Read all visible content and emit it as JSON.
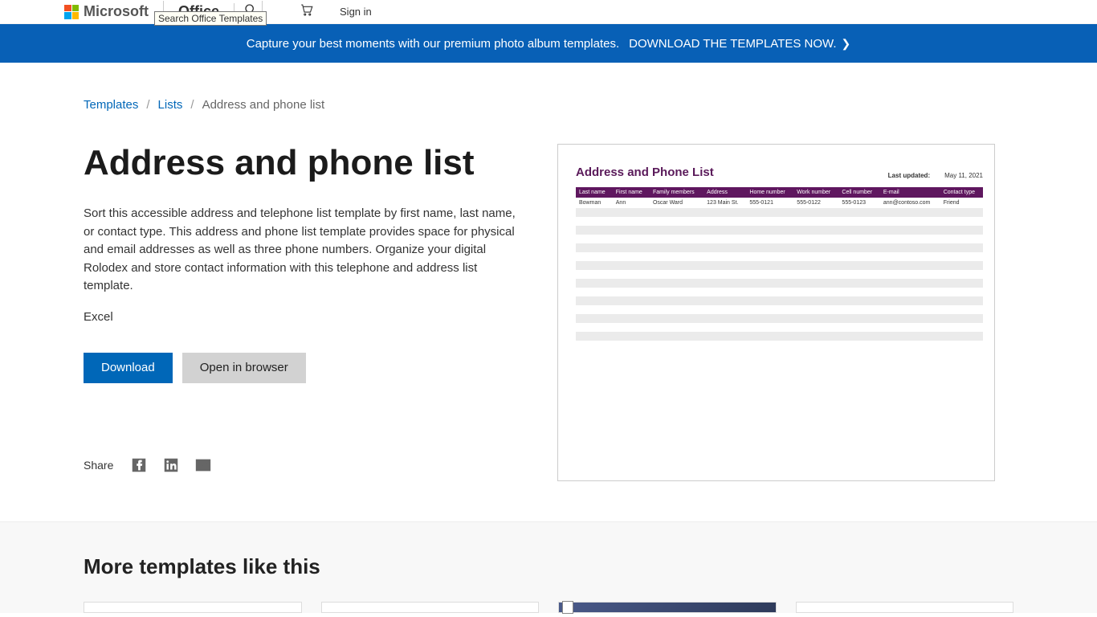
{
  "header": {
    "brand": "Microsoft",
    "product": "Office",
    "search_tooltip": "Search Office Templates",
    "signin": "Sign in"
  },
  "promo": {
    "text": "Capture your best moments with our premium photo album templates.",
    "cta": "DOWNLOAD THE TEMPLATES NOW."
  },
  "breadcrumbs": {
    "root": "Templates",
    "mid": "Lists",
    "leaf": "Address and phone list"
  },
  "template": {
    "title": "Address and phone list",
    "description": "Sort this accessible address and telephone list template by first name, last name, or contact type. This address and phone list template provides space for physical and email addresses as well as three phone numbers. Organize your digital Rolodex and store contact information with this telephone and address list template.",
    "app": "Excel",
    "download": "Download",
    "open": "Open in browser",
    "share": "Share"
  },
  "preview": {
    "title": "Address and Phone List",
    "updated_label": "Last updated:",
    "updated_date": "May 11, 2021",
    "cols": {
      "c0": "Last name",
      "c1": "First name",
      "c2": "Family members",
      "c3": "Address",
      "c4": "Home number",
      "c5": "Work number",
      "c6": "Cell number",
      "c7": "E-mail",
      "c8": "Contact type"
    },
    "row": {
      "c0": "Bowman",
      "c1": "Ann",
      "c2": "Oscar Ward",
      "c3": "123 Main St.",
      "c4": "555-0121",
      "c5": "555-0122",
      "c6": "555-0123",
      "c7": "ann@contoso.com",
      "c8": "Friend"
    }
  },
  "more": {
    "title": "More templates like this"
  }
}
